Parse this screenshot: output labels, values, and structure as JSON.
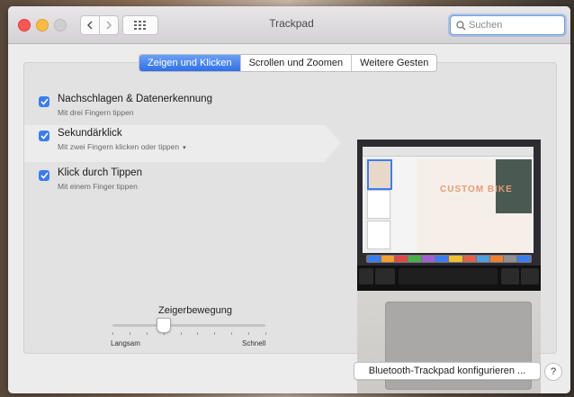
{
  "window": {
    "title": "Trackpad"
  },
  "search": {
    "placeholder": "Suchen"
  },
  "tabs": [
    {
      "label": "Zeigen und Klicken",
      "selected": true
    },
    {
      "label": "Scrollen und Zoomen",
      "selected": false
    },
    {
      "label": "Weitere Gesten",
      "selected": false
    }
  ],
  "options": [
    {
      "title": "Nachschlagen & Datenerkennung",
      "subtitle": "Mit drei Fingern tippen",
      "checked": true
    },
    {
      "title": "Sekundärklick",
      "subtitle": "Mit zwei Fingern klicken oder tippen",
      "checked": true,
      "has_menu": true
    },
    {
      "title": "Klick durch Tippen",
      "subtitle": "Mit einem Finger tippen",
      "checked": true
    }
  ],
  "pointer_speed": {
    "title": "Zeigerbewegung",
    "min_label": "Langsam",
    "max_label": "Schnell",
    "value_fraction": 0.33,
    "ticks": 10
  },
  "preview": {
    "doc_text": "CUSTOM BIKE"
  },
  "footer": {
    "bluetooth_button": "Bluetooth-Trackpad konfigurieren ...",
    "help_label": "?"
  },
  "colors": {
    "accent": "#3b7df0",
    "close": "#fc5753",
    "minimize": "#fdbc40"
  }
}
